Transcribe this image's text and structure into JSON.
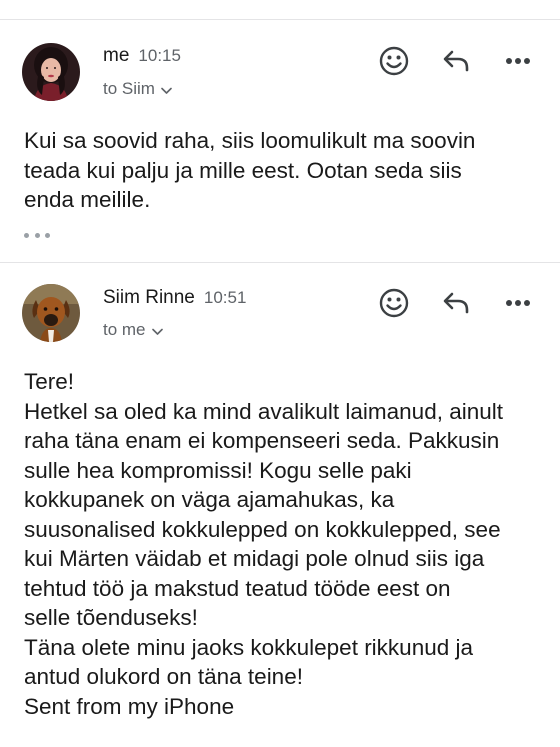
{
  "messages": [
    {
      "sender": "me",
      "time": "10:15",
      "recipient": "to Siim",
      "avatar_icon": "woman-portrait-avatar",
      "body_lines": [
        "Kui sa soovid raha, siis loomulikult ma soovin",
        "teada kui palju ja mille eest. Ootan seda siis",
        "enda meilile."
      ],
      "has_trimmed_content": true
    },
    {
      "sender": "Siim Rinne",
      "time": "10:51",
      "recipient": "to me",
      "avatar_icon": "dog-portrait-avatar",
      "body_lines": [
        "Tere!",
        "Hetkel sa oled ka mind avalikult laimanud, ainult",
        "raha täna enam ei kompenseeri seda. Pakkusin",
        "sulle hea kompromissi! Kogu selle paki",
        "kokkupanek on väga ajamahukas, ka",
        "suusonalised kokkulepped on kokkulepped, see",
        "kui Märten väidab et midagi pole olnud siis iga",
        "tehtud töö ja makstud teatud tööde eest on",
        "selle tõenduseks!",
        "Täna olete minu jaoks kokkulepet rikkunud ja",
        "antud olukord on täna teine!",
        "Sent from my iPhone"
      ],
      "has_trimmed_content": false
    }
  ],
  "actions": {
    "emoji_icon": "smiley-face-icon",
    "reply_icon": "reply-arrow-icon",
    "more_icon": "more-dots-icon"
  },
  "colors": {
    "text": "#1a1a1a",
    "secondary_text": "#5f6368",
    "icon": "#3c4043",
    "divider": "#e4e4e6"
  }
}
